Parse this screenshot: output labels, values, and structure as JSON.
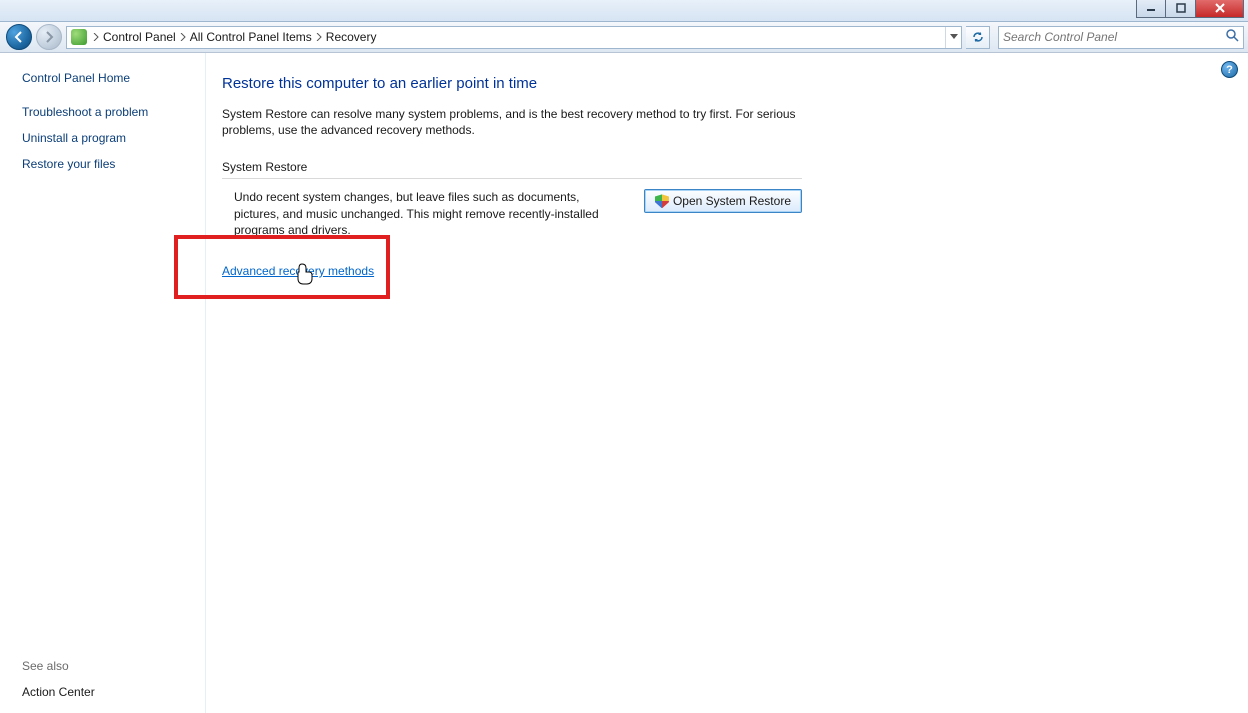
{
  "breadcrumb": {
    "item1": "Control Panel",
    "item2": "All Control Panel Items",
    "item3": "Recovery"
  },
  "search": {
    "placeholder": "Search Control Panel"
  },
  "sidebar": {
    "home": "Control Panel Home",
    "links": {
      "troubleshoot": "Troubleshoot a problem",
      "uninstall": "Uninstall a program",
      "restore_files": "Restore your files"
    },
    "see_also_label": "See also",
    "see_also_item": "Action Center"
  },
  "content": {
    "title": "Restore this computer to an earlier point in time",
    "description": "System Restore can resolve many system problems, and is the best recovery method to try first. For serious problems, use the advanced recovery methods.",
    "section_head": "System Restore",
    "section_text": "Undo recent system changes, but leave files such as documents, pictures, and music unchanged. This might remove recently-installed programs and drivers.",
    "open_button": "Open System Restore",
    "advanced_link": "Advanced recovery methods"
  },
  "help_glyph": "?"
}
